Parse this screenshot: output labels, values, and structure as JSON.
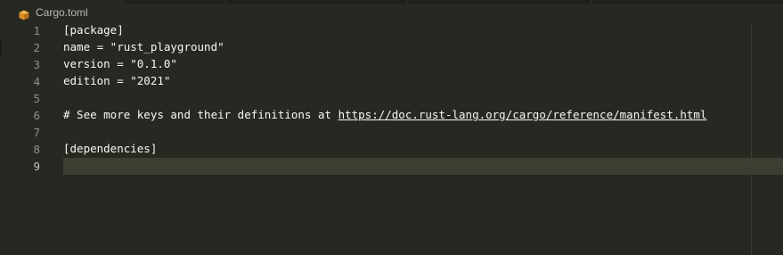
{
  "tab": {
    "icon": "package-icon",
    "label": "Cargo.toml"
  },
  "editor": {
    "active_line": 9,
    "lines": [
      {
        "num": "1",
        "text": "[package]"
      },
      {
        "num": "2",
        "text": "name = \"rust_playground\""
      },
      {
        "num": "3",
        "text": "version = \"0.1.0\""
      },
      {
        "num": "4",
        "text": "edition = \"2021\""
      },
      {
        "num": "5",
        "text": ""
      },
      {
        "num": "6",
        "text_prefix": "# See more keys and their definitions at ",
        "link": "https://doc.rust-lang.org/cargo/reference/manifest.html"
      },
      {
        "num": "7",
        "text": ""
      },
      {
        "num": "8",
        "text": "[dependencies]"
      },
      {
        "num": "9",
        "text": ""
      }
    ]
  },
  "colors": {
    "background": "#272822",
    "text": "#f8f8f2",
    "line_number": "#90908a",
    "active_line": "#3e3d32",
    "tab_icon": "#e8a33d"
  }
}
